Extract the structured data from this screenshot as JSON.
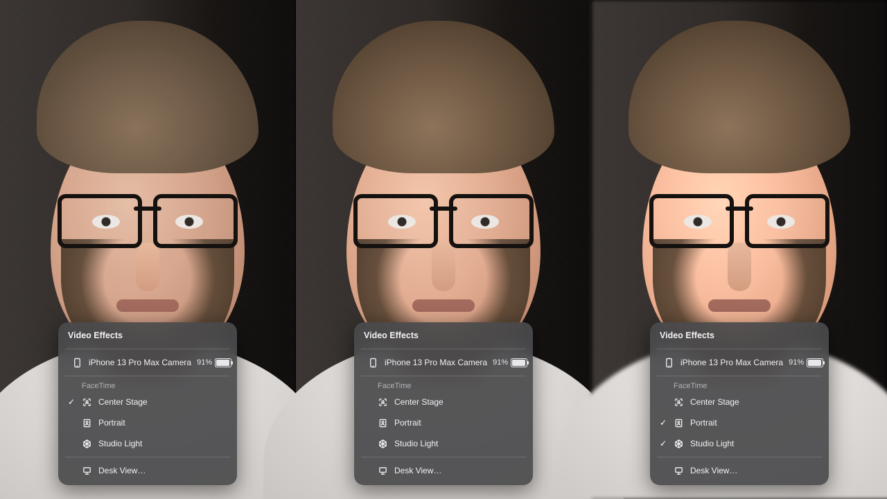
{
  "panel": {
    "title": "Video Effects",
    "device_label": "iPhone 13 Pro Max  Camera",
    "battery_text": "91%",
    "section_label": "FaceTime",
    "options": [
      {
        "key": "center_stage",
        "label": "Center Stage"
      },
      {
        "key": "portrait",
        "label": "Portrait"
      },
      {
        "key": "studio_light",
        "label": "Studio Light"
      }
    ],
    "desk_view_label": "Desk View…"
  },
  "panes": [
    {
      "checked": {
        "center_stage": true,
        "portrait": false,
        "studio_light": false
      }
    },
    {
      "checked": {
        "center_stage": false,
        "portrait": false,
        "studio_light": false
      }
    },
    {
      "checked": {
        "center_stage": false,
        "portrait": true,
        "studio_light": true
      }
    }
  ]
}
